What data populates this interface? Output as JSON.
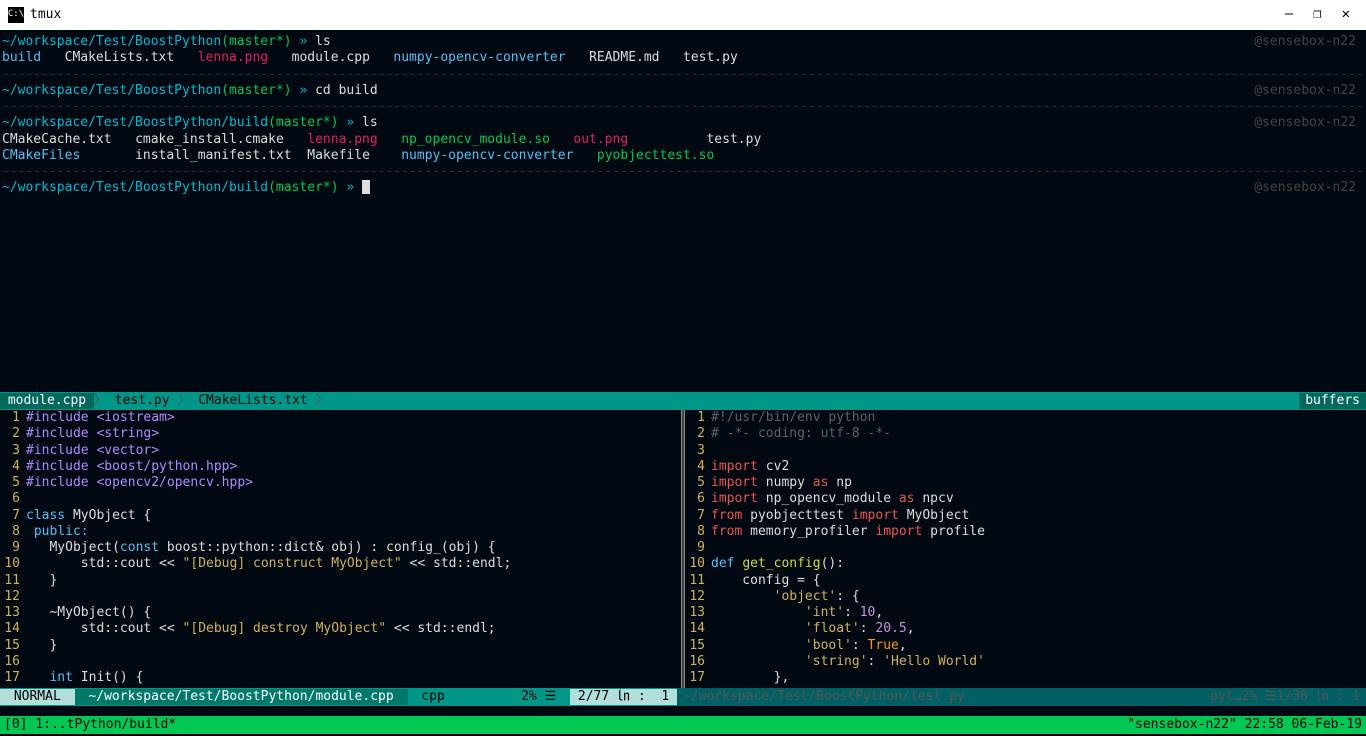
{
  "window": {
    "title": "tmux"
  },
  "win_controls": {
    "min": "—",
    "max": "❐",
    "close": "✕"
  },
  "right_user": "@sensebox-n22",
  "prompts": {
    "p1": {
      "path": "~/workspace/Test/BoostPython",
      "branch": "(master*)",
      "sep": " » ",
      "cmd": "ls"
    },
    "p2": {
      "path": "~/workspace/Test/BoostPython",
      "branch": "(master*)",
      "sep": " » ",
      "cmd": "cd build"
    },
    "p3": {
      "path": "~/workspace/Test/BoostPython/build",
      "branch": "(master*)",
      "sep": " » ",
      "cmd": "ls"
    },
    "p4": {
      "path": "~/workspace/Test/BoostPython/build",
      "branch": "(master*)",
      "sep": " » ",
      "cmd": ""
    }
  },
  "ls1": {
    "build": "build",
    "cmake": "CMakeLists.txt",
    "lenna": "lenna.png",
    "module": "module.cpp",
    "conv": "numpy-opencv-converter",
    "readme": "README.md",
    "test": "test.py"
  },
  "ls2": {
    "r1c1": "CMakeCache.txt",
    "r1c2": "cmake_install.cmake",
    "r1c3": "lenna.png",
    "r1c4": "np_opencv_module.so",
    "r1c5": "out.png",
    "r1c6": "test.py",
    "r2c1": "CMakeFiles",
    "r2c2": "install_manifest.txt",
    "r2c3": "Makefile",
    "r2c4": "numpy-opencv-converter",
    "r2c5": "pyobjecttest.so"
  },
  "tabs": {
    "t1": " module.cpp ",
    "t2": " test.py ",
    "t3": " CMakeLists.txt ",
    "arrow": "〉",
    "right": "buffers"
  },
  "left_code": {
    "l1": "#include <iostream>",
    "l2": "#include <string>",
    "l3": "#include <vector>",
    "l4": "#include <boost/python.hpp>",
    "l5": "#include <opencv2/opencv.hpp>",
    "l6": "",
    "l7a": "class ",
    "l7b": "MyObject {",
    "l8": " public:",
    "l9a": "   MyObject(",
    "l9b": "const ",
    "l9c": "boost::python::dict& obj) : config_(obj) {",
    "l10a": "       std::cout << ",
    "l10b": "\"[Debug] construct MyObject\"",
    "l10c": " << std::endl;",
    "l11": "   }",
    "l12": "",
    "l13": "   ~MyObject() {",
    "l14a": "       std::cout << ",
    "l14b": "\"[Debug] destroy MyObject\"",
    "l14c": " << std::endl;",
    "l15": "   }",
    "l16": "",
    "l17a": "   ",
    "l17b": "int ",
    "l17c": "Init() {"
  },
  "right_code": {
    "l1": "#!/usr/bin/env python",
    "l2": "# -*- coding: utf-8 -*-",
    "l3": "",
    "l4a": "import ",
    "l4b": "cv2",
    "l5a": "import ",
    "l5b": "numpy ",
    "l5c": "as ",
    "l5d": "np",
    "l6a": "import ",
    "l6b": "np_opencv_module ",
    "l6c": "as ",
    "l6d": "npcv",
    "l7a": "from ",
    "l7b": "pyobjecttest ",
    "l7c": "import ",
    "l7d": "MyObject",
    "l8a": "from ",
    "l8b": "memory_profiler ",
    "l8c": "import ",
    "l8d": "profile",
    "l9": "",
    "l10a": "def ",
    "l10b": "get_config",
    "l10c": "():",
    "l11": "    config = {",
    "l12a": "        ",
    "l12b": "'object'",
    "l12c": ": {",
    "l13a": "            ",
    "l13b": "'int'",
    "l13c": ": ",
    "l13d": "10",
    "l13e": ",",
    "l14a": "            ",
    "l14b": "'float'",
    "l14c": ": ",
    "l14d": "20.5",
    "l14e": ",",
    "l15a": "            ",
    "l15b": "'bool'",
    "l15c": ": ",
    "l15d": "True",
    "l15e": ",",
    "l16a": "            ",
    "l16b": "'string'",
    "l16c": ": ",
    "l16d": "'Hello World'",
    "l17": "        },"
  },
  "status": {
    "mode": " NORMAL ",
    "path": " ~/workspace/Test/BoostPython/module.cpp ",
    "ft": " cpp ",
    "pct": " 2% ☰ ",
    "pos": " 2/77 ㏑ :  1 ",
    "rpath": " ~/workspace/Test/BoostPython/test.py ",
    "rft": "pyt…",
    "rpct": " 2% ☰ ",
    "rpos": " 1/38 ㏑ :  1 "
  },
  "tmux": {
    "left": "[0] 1:..tPython/build*",
    "right": "\"sensebox-n22\" 22:58 06-Feb-19"
  },
  "dashes": "------------------------------------------------------------------------------------------------------------------------------------------------------------------------------------------------------"
}
